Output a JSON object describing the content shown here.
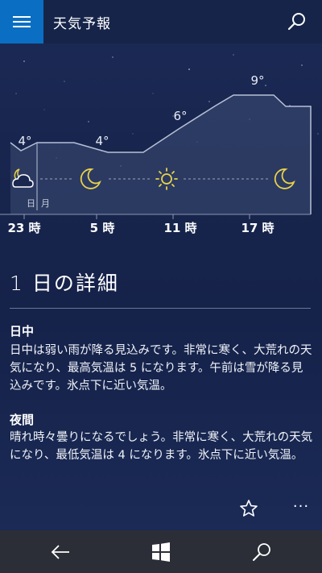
{
  "header": {
    "title": "天気予報",
    "menu_icon": "hamburger-menu-icon",
    "search_icon": "search-icon",
    "accent_color": "#0a6fc2"
  },
  "forecast": {
    "temperatures": {
      "t1": "4°",
      "t2": "4°",
      "t3": "6°",
      "t4": "9°"
    },
    "weather_icons": [
      "partly-cloudy-night-icon",
      "moon-icon",
      "sun-icon",
      "moon-icon"
    ],
    "day_markers": {
      "day1": "日",
      "day2": "月"
    },
    "hours": [
      "23 時",
      "5 時",
      "11 時",
      "17 時"
    ]
  },
  "details": {
    "title": "1 日の詳細",
    "daytime_heading": "日中",
    "daytime_text": "日中は弱い雨が降る見込みです。非常に寒く、大荒れの天気になり、最高気温は 5 になります。午前は雪が降る見込みです。氷点下に近い気温。",
    "night_heading": "夜間",
    "night_text": "晴れ時々曇りになるでしょう。非常に寒く、大荒れの天気になり、最低気温は 4 になります。氷点下に近い気温。"
  },
  "actions": {
    "favorite_icon": "star-icon",
    "more_label": "···"
  },
  "navbar": {
    "back_icon": "back-arrow-icon",
    "home_icon": "windows-logo-icon",
    "search_icon": "search-icon"
  }
}
